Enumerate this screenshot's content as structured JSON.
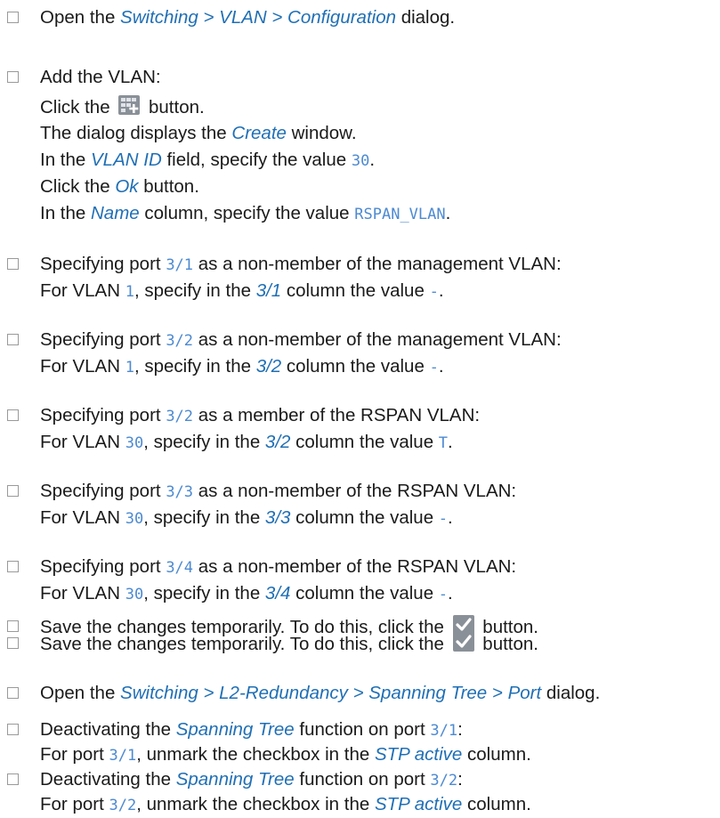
{
  "steps": [
    {
      "parts": [
        {
          "t": "Open the "
        },
        {
          "t": "Switching > VLAN > Configuration",
          "k": "hl"
        },
        {
          "t": " dialog."
        }
      ]
    },
    {
      "parts": [
        {
          "t": "Add the VLAN:"
        }
      ]
    },
    {
      "sub": true,
      "parts": [
        {
          "t": "Click the "
        },
        {
          "icon": "add-table-icon"
        },
        {
          "t": " button."
        }
      ]
    },
    {
      "sub": true,
      "parts": [
        {
          "t": "The dialog displays the "
        },
        {
          "t": "Create",
          "k": "hl"
        },
        {
          "t": " window."
        }
      ]
    },
    {
      "sub": true,
      "parts": [
        {
          "t": "In the "
        },
        {
          "t": "VLAN ID",
          "k": "hl"
        },
        {
          "t": " field, specify the value "
        },
        {
          "t": "30",
          "k": "mono"
        },
        {
          "t": "."
        }
      ]
    },
    {
      "sub": true,
      "parts": [
        {
          "t": "Click the "
        },
        {
          "t": "Ok",
          "k": "hl"
        },
        {
          "t": " button."
        }
      ]
    },
    {
      "sub": true,
      "parts": [
        {
          "t": "In the "
        },
        {
          "t": "Name",
          "k": "hl"
        },
        {
          "t": " column, specify the value "
        },
        {
          "t": "RSPAN_VLAN",
          "k": "mono"
        },
        {
          "t": "."
        }
      ]
    },
    {
      "parts": [
        {
          "t": "Specifying port "
        },
        {
          "t": "3/1",
          "k": "mono"
        },
        {
          "t": " as a non-member of the management VLAN:"
        }
      ]
    },
    {
      "sub": true,
      "parts": [
        {
          "t": "For VLAN "
        },
        {
          "t": "1",
          "k": "mono"
        },
        {
          "t": ", specify in the "
        },
        {
          "t": "3/1",
          "k": "hl"
        },
        {
          "t": " column the value "
        },
        {
          "t": "-",
          "k": "mono"
        },
        {
          "t": "."
        }
      ]
    },
    {
      "parts": [
        {
          "t": "Specifying port "
        },
        {
          "t": "3/2",
          "k": "mono"
        },
        {
          "t": " as a non-member of the management VLAN:"
        }
      ]
    },
    {
      "sub": true,
      "parts": [
        {
          "t": "For VLAN "
        },
        {
          "t": "1",
          "k": "mono"
        },
        {
          "t": ", specify in the "
        },
        {
          "t": "3/2",
          "k": "hl"
        },
        {
          "t": " column the value "
        },
        {
          "t": "-",
          "k": "mono"
        },
        {
          "t": "."
        }
      ]
    },
    {
      "parts": [
        {
          "t": "Specifying port "
        },
        {
          "t": "3/2",
          "k": "mono"
        },
        {
          "t": " as a member of the RSPAN VLAN:"
        }
      ]
    },
    {
      "sub": true,
      "parts": [
        {
          "t": "For VLAN "
        },
        {
          "t": "30",
          "k": "mono"
        },
        {
          "t": ", specify in the "
        },
        {
          "t": "3/2",
          "k": "hl"
        },
        {
          "t": " column the value "
        },
        {
          "t": "T",
          "k": "mono"
        },
        {
          "t": "."
        }
      ]
    },
    {
      "parts": [
        {
          "t": "Specifying port "
        },
        {
          "t": "3/3",
          "k": "mono"
        },
        {
          "t": " as a non-member of the RSPAN VLAN:"
        }
      ]
    },
    {
      "sub": true,
      "parts": [
        {
          "t": "For VLAN "
        },
        {
          "t": "30",
          "k": "mono"
        },
        {
          "t": ", specify in the "
        },
        {
          "t": "3/3",
          "k": "hl"
        },
        {
          "t": " column the value "
        },
        {
          "t": "-",
          "k": "mono"
        },
        {
          "t": "."
        }
      ]
    },
    {
      "parts": [
        {
          "t": "Specifying port "
        },
        {
          "t": "3/4",
          "k": "mono"
        },
        {
          "t": " as a non-member of the RSPAN VLAN:"
        }
      ]
    },
    {
      "sub": true,
      "parts": [
        {
          "t": "For VLAN "
        },
        {
          "t": "30",
          "k": "mono"
        },
        {
          "t": ", specify in the "
        },
        {
          "t": "3/4",
          "k": "hl"
        },
        {
          "t": " column the value "
        },
        {
          "t": "-",
          "k": "mono"
        },
        {
          "t": "."
        }
      ]
    },
    {
      "parts": [
        {
          "t": "Save the changes temporarily. To do this, click the "
        },
        {
          "icon": "checkmark-icon"
        },
        {
          "t": " button."
        }
      ]
    },
    {
      "parts": [
        {
          "t": "Open the "
        },
        {
          "t": "Switching > L2-Redundancy > Spanning Tree > Port",
          "k": "hl"
        },
        {
          "t": " dialog."
        }
      ]
    },
    {
      "parts": [
        {
          "t": "Deactivating the "
        },
        {
          "t": "Spanning Tree",
          "k": "hl"
        },
        {
          "t": " function on port "
        },
        {
          "t": "3/1",
          "k": "mono"
        },
        {
          "t": ":"
        }
      ]
    },
    {
      "sub": true,
      "parts": [
        {
          "t": "For port "
        },
        {
          "t": "3/1",
          "k": "mono"
        },
        {
          "t": ", unmark the checkbox in the "
        },
        {
          "t": "STP active",
          "k": "hl"
        },
        {
          "t": " column."
        }
      ]
    },
    {
      "parts": [
        {
          "t": "Deactivating the "
        },
        {
          "t": "Spanning Tree",
          "k": "hl"
        },
        {
          "t": " function on port "
        },
        {
          "t": "3/2",
          "k": "mono"
        },
        {
          "t": ":"
        }
      ]
    },
    {
      "sub": true,
      "parts": [
        {
          "t": "For port "
        },
        {
          "t": "3/2",
          "k": "mono"
        },
        {
          "t": ", unmark the checkbox in the "
        },
        {
          "t": "STP active",
          "k": "hl"
        },
        {
          "t": " column."
        }
      ]
    },
    {
      "parts": [
        {
          "t": "Save the changes temporarily. To do this, click the "
        },
        {
          "icon": "checkmark-icon"
        },
        {
          "t": " button."
        }
      ]
    }
  ],
  "colors": {
    "link": "#1f6fb5",
    "code": "#4d8ad1",
    "checkbox": "#9a9a9a"
  }
}
